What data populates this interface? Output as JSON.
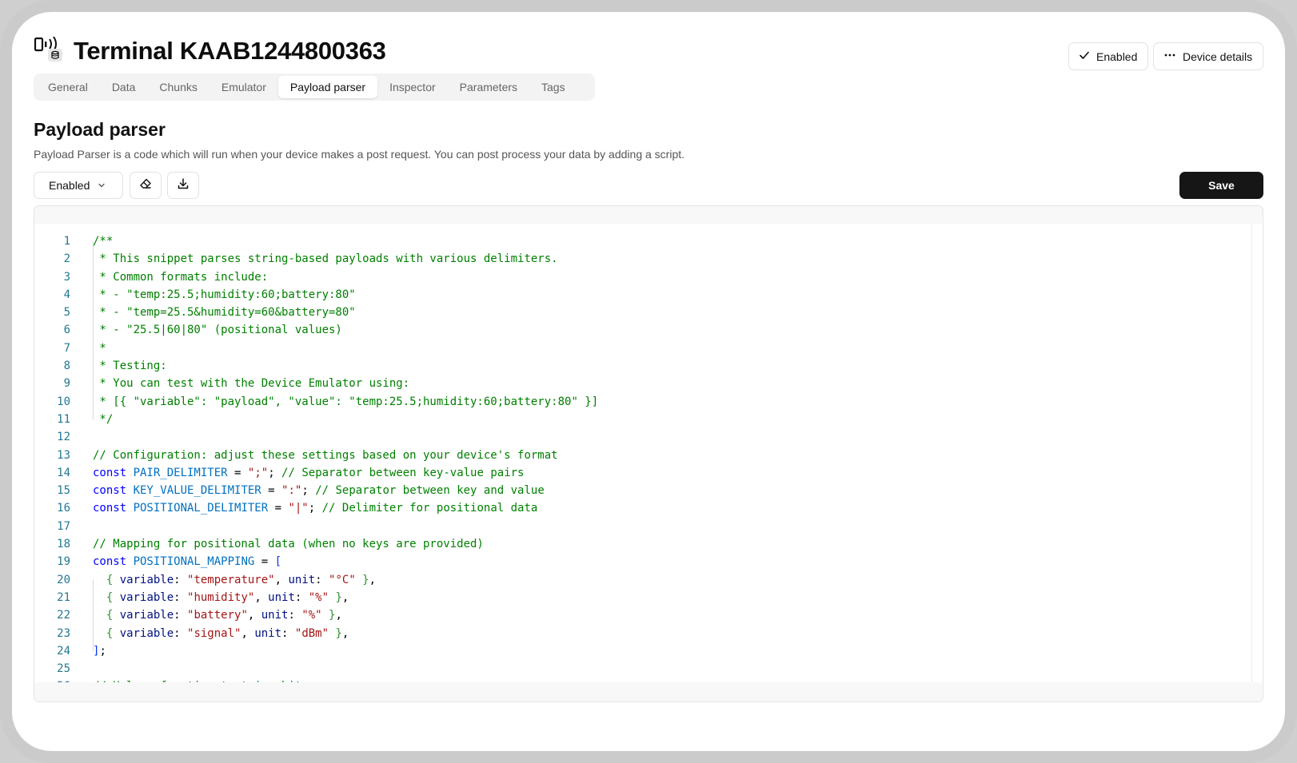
{
  "header": {
    "title": "Terminal KAAB1244800363",
    "enabled_label": "Enabled",
    "details_label": "Device details"
  },
  "tabs": [
    {
      "label": "General",
      "active": false
    },
    {
      "label": "Data",
      "active": false
    },
    {
      "label": "Chunks",
      "active": false
    },
    {
      "label": "Emulator",
      "active": false
    },
    {
      "label": "Payload parser",
      "active": true
    },
    {
      "label": "Inspector",
      "active": false
    },
    {
      "label": "Parameters",
      "active": false
    },
    {
      "label": "Tags",
      "active": false
    }
  ],
  "section": {
    "title": "Payload parser",
    "description": "Payload Parser is a code which will run when your device makes a post request. You can post process your data by adding a script."
  },
  "toolbar": {
    "status_value": "Enabled",
    "save_label": "Save"
  },
  "icons": {
    "device": "device-icon",
    "check": "check-icon",
    "more": "more-horizontal-icon",
    "chevron": "chevron-down-icon",
    "eraser": "eraser-icon",
    "download": "download-icon"
  },
  "colors": {
    "primary_button": "#161616",
    "comment": "#008000",
    "keyword": "#0000ff",
    "string": "#a31515",
    "line_number": "#237893"
  },
  "editor": {
    "lines": [
      [
        [
          "c",
          "/**"
        ]
      ],
      [
        [
          "c",
          " * This snippet parses string-based payloads with various delimiters."
        ]
      ],
      [
        [
          "c",
          " * Common formats include:"
        ]
      ],
      [
        [
          "c",
          " * - \"temp:25.5;humidity:60;battery:80\""
        ]
      ],
      [
        [
          "c",
          " * - \"temp=25.5&humidity=60&battery=80\""
        ]
      ],
      [
        [
          "c",
          " * - \"25.5|60|80\" (positional values)"
        ]
      ],
      [
        [
          "c",
          " *"
        ]
      ],
      [
        [
          "c",
          " * Testing:"
        ]
      ],
      [
        [
          "c",
          " * You can test with the Device Emulator using:"
        ]
      ],
      [
        [
          "c",
          " * [{ \"variable\": \"payload\", \"value\": \"temp:25.5;humidity:60;battery:80\" }]"
        ]
      ],
      [
        [
          "c",
          " */"
        ]
      ],
      [],
      [
        [
          "c",
          "// Configuration: adjust these settings based on your device's format"
        ]
      ],
      [
        [
          "k",
          "const "
        ],
        [
          "o",
          "PAIR_DELIMITER"
        ],
        [
          "t",
          " = "
        ],
        [
          "s",
          "\";\""
        ],
        [
          "t",
          "; "
        ],
        [
          "c",
          "// Separator between key-value pairs"
        ]
      ],
      [
        [
          "k",
          "const "
        ],
        [
          "o",
          "KEY_VALUE_DELIMITER"
        ],
        [
          "t",
          " = "
        ],
        [
          "s",
          "\":\""
        ],
        [
          "t",
          "; "
        ],
        [
          "c",
          "// Separator between key and value"
        ]
      ],
      [
        [
          "k",
          "const "
        ],
        [
          "o",
          "POSITIONAL_DELIMITER"
        ],
        [
          "t",
          " = "
        ],
        [
          "s",
          "\"|\""
        ],
        [
          "t",
          "; "
        ],
        [
          "c",
          "// Delimiter for positional data"
        ]
      ],
      [],
      [
        [
          "c",
          "// Mapping for positional data (when no keys are provided)"
        ]
      ],
      [
        [
          "k",
          "const "
        ],
        [
          "o",
          "POSITIONAL_MAPPING"
        ],
        [
          "t",
          " = "
        ],
        [
          "b",
          "["
        ]
      ],
      [
        [
          "t",
          "  "
        ],
        [
          "g",
          "{"
        ],
        [
          "i",
          " variable"
        ],
        [
          "t",
          ": "
        ],
        [
          "s",
          "\"temperature\""
        ],
        [
          "t",
          ", "
        ],
        [
          "i",
          "unit"
        ],
        [
          "t",
          ": "
        ],
        [
          "s",
          "\"°C\""
        ],
        [
          "g",
          " }"
        ],
        [
          "t",
          ","
        ]
      ],
      [
        [
          "t",
          "  "
        ],
        [
          "g",
          "{"
        ],
        [
          "i",
          " variable"
        ],
        [
          "t",
          ": "
        ],
        [
          "s",
          "\"humidity\""
        ],
        [
          "t",
          ", "
        ],
        [
          "i",
          "unit"
        ],
        [
          "t",
          ": "
        ],
        [
          "s",
          "\"%\""
        ],
        [
          "g",
          " }"
        ],
        [
          "t",
          ","
        ]
      ],
      [
        [
          "t",
          "  "
        ],
        [
          "g",
          "{"
        ],
        [
          "i",
          " variable"
        ],
        [
          "t",
          ": "
        ],
        [
          "s",
          "\"battery\""
        ],
        [
          "t",
          ", "
        ],
        [
          "i",
          "unit"
        ],
        [
          "t",
          ": "
        ],
        [
          "s",
          "\"%\""
        ],
        [
          "g",
          " }"
        ],
        [
          "t",
          ","
        ]
      ],
      [
        [
          "t",
          "  "
        ],
        [
          "g",
          "{"
        ],
        [
          "i",
          " variable"
        ],
        [
          "t",
          ": "
        ],
        [
          "s",
          "\"signal\""
        ],
        [
          "t",
          ", "
        ],
        [
          "i",
          "unit"
        ],
        [
          "t",
          ": "
        ],
        [
          "s",
          "\"dBm\""
        ],
        [
          "g",
          " }"
        ],
        [
          "t",
          ","
        ]
      ],
      [
        [
          "b",
          "]"
        ],
        [
          "t",
          ";"
        ]
      ],
      [],
      [
        [
          "c",
          "// Helper function to trim whitespace"
        ]
      ]
    ]
  }
}
